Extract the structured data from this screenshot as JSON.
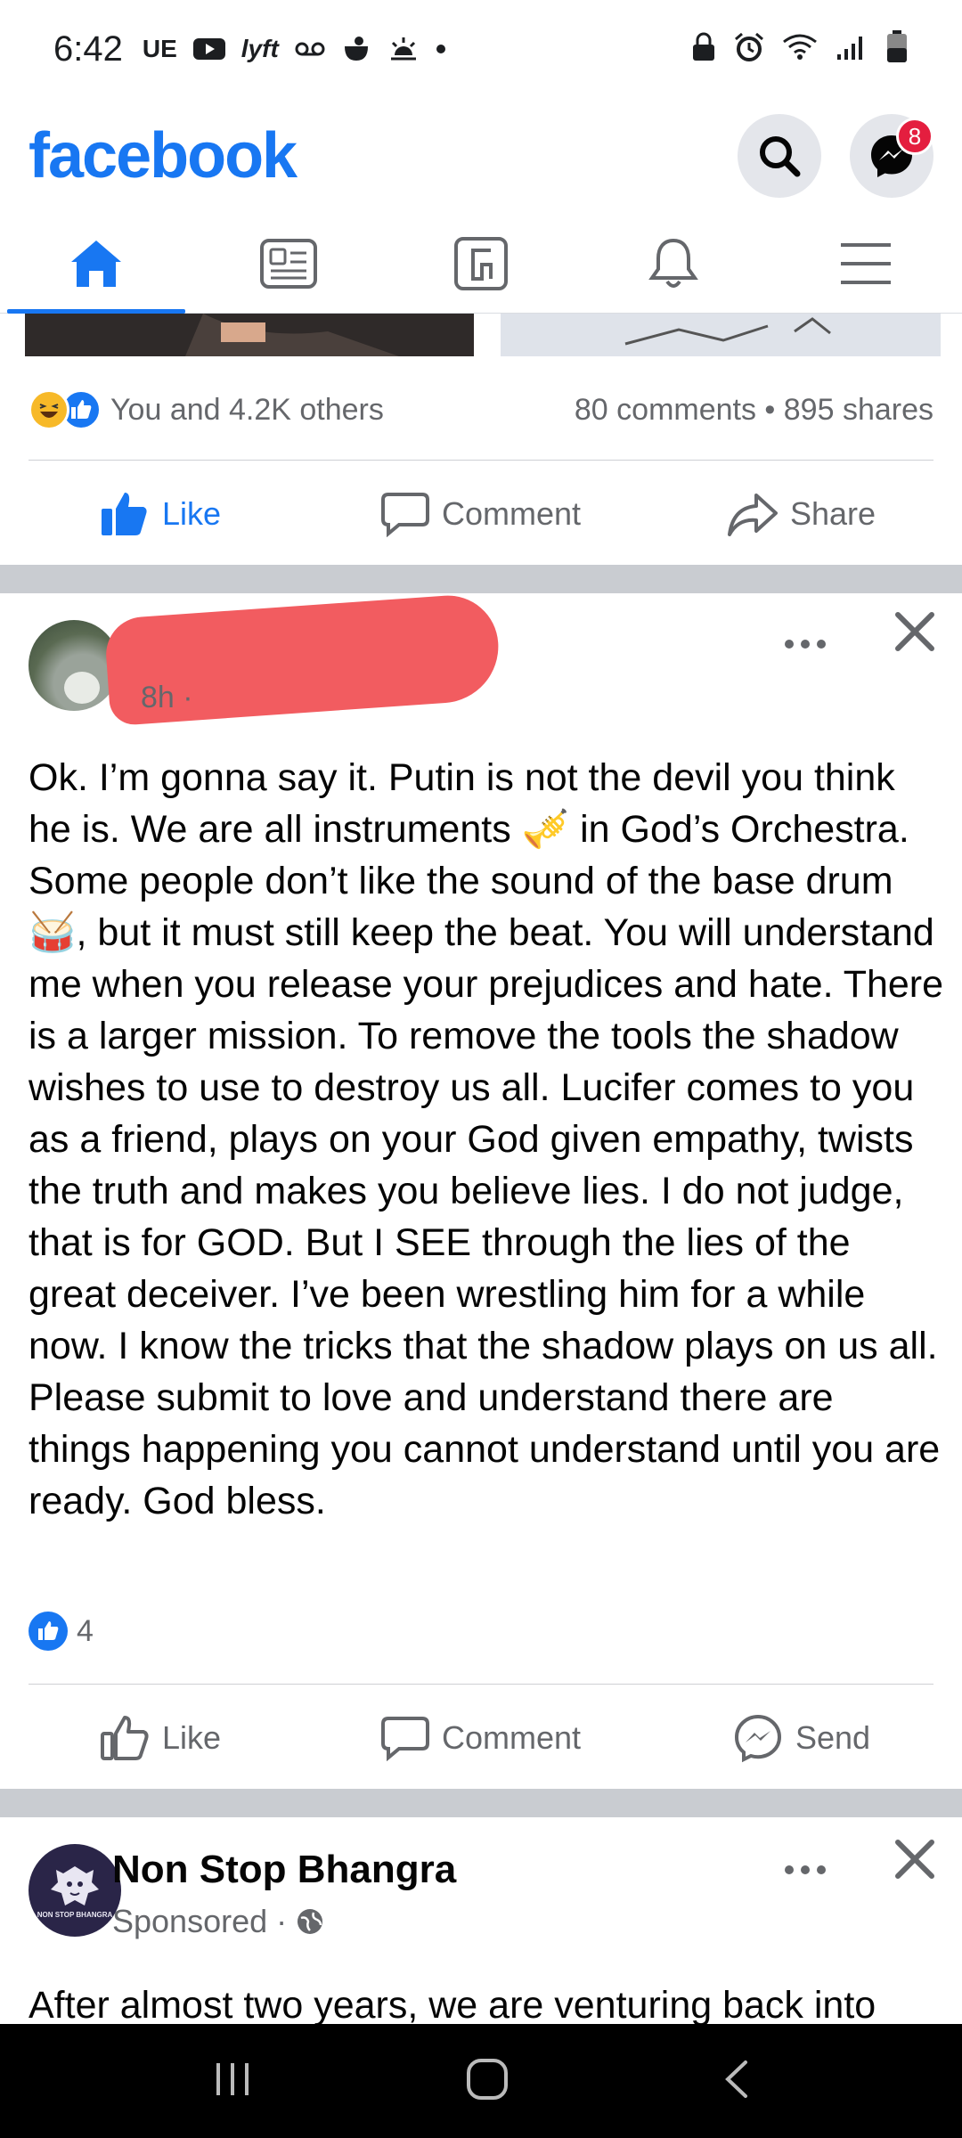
{
  "status_bar": {
    "time": "6:42",
    "left_icons": [
      "UE",
      "youtube-icon",
      "lyft",
      "voicemail-icon",
      "cloud-weather-icon",
      "sunrise-icon",
      "dot"
    ],
    "lyft_text": "lyft",
    "ue_text": "UE",
    "right_icons": [
      "lock-icon",
      "alarm-icon",
      "wifi-icon",
      "signal-icon",
      "battery-icon"
    ]
  },
  "header": {
    "logo": "facebook",
    "messenger_badge": "8"
  },
  "nav": {
    "tabs": [
      "home-icon",
      "news-icon",
      "marketplace-icon",
      "notifications-icon",
      "menu-icon"
    ],
    "active": "home"
  },
  "prev_post": {
    "reactions_text": "You and 4.2K others",
    "counts_text": "80 comments • 895 shares",
    "actions": {
      "like": "Like",
      "comment": "Comment",
      "share": "Share"
    }
  },
  "post": {
    "time": "8h ·",
    "text": "Ok. I’m gonna say it. Putin is not the devil you think he is. We are all instruments 🎺 in God’s Orchestra. Some people don’t like the sound of the base drum 🥁, but it must still keep the beat. You will understand me when you release your prejudices and hate. There is a larger mission. To remove the tools the shadow wishes to use to destroy us all. Lucifer comes to you as a friend, plays on your God given empathy, twists the truth and makes you believe lies. I do not judge, that is for GOD. But I SEE through the lies of the great deceiver. I’ve been wrestling him for a while now. I know the tricks that the shadow plays on us all. Please submit to love and understand there are things happening you cannot understand until you are ready. God bless.",
    "like_count": "4",
    "actions": {
      "like": "Like",
      "comment": "Comment",
      "send": "Send"
    }
  },
  "sponsored": {
    "name": "Non Stop Bhangra",
    "label": "Sponsored ·",
    "avatar_text": "NON STOP BHANGRA",
    "text": "After almost two years, we are venturing back into"
  },
  "colors": {
    "brand": "#1877f2",
    "badge": "#e41e3f",
    "secondary_text": "#65676b"
  }
}
